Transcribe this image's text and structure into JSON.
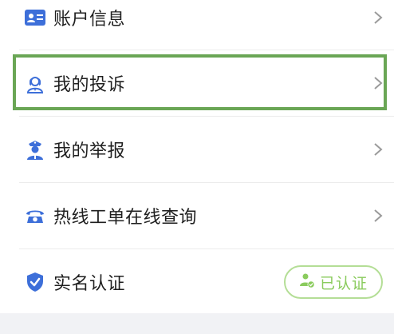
{
  "menu": {
    "items": [
      {
        "label": "账户信息",
        "icon": "id-card-icon"
      },
      {
        "label": "我的投诉",
        "icon": "customer-service-icon"
      },
      {
        "label": "我的举报",
        "icon": "police-officer-icon"
      },
      {
        "label": "热线工单在线查询",
        "icon": "telephone-icon"
      },
      {
        "label": "实名认证",
        "icon": "shield-check-icon"
      }
    ],
    "verified_badge": {
      "label": "已认证",
      "icon": "user-verified-icon"
    }
  },
  "colors": {
    "icon_blue": "#3d6fd9",
    "highlight_green": "#6aa655",
    "badge_green": "#8acb5d",
    "badge_border": "#b4de96",
    "chevron": "#9b9b9b"
  }
}
